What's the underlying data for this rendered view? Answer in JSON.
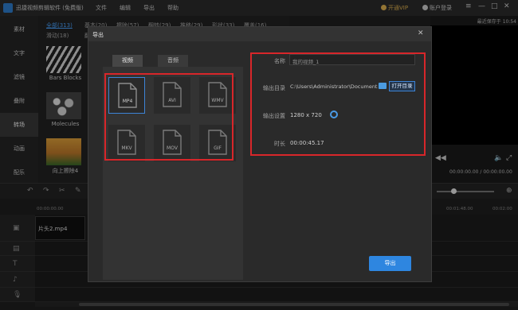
{
  "app": {
    "title": "迅捷视频剪辑软件 (免费版)",
    "menu": [
      "文件",
      "编辑",
      "导出",
      "帮助"
    ],
    "vip_label": "开通VIP",
    "login_label": "账户登录",
    "window_controls": [
      "≡",
      "—",
      "□",
      "✕"
    ]
  },
  "sidebar": {
    "items": [
      {
        "label": "素材",
        "active": false
      },
      {
        "label": "文字",
        "active": false
      },
      {
        "label": "滤镜",
        "active": false
      },
      {
        "label": "叠附",
        "active": false
      },
      {
        "label": "转场",
        "active": true
      },
      {
        "label": "动画",
        "active": false
      },
      {
        "label": "配乐",
        "active": false
      }
    ]
  },
  "resources": {
    "tabs_row1": [
      "全部(313)",
      "基本(20)",
      "擦除(57)",
      "翻转(29)",
      "推移(29)",
      "形状(33)",
      "覆盖(16)"
    ],
    "tabs_row2": [
      "滑动(18)",
      "翻"
    ],
    "thumbnails": [
      {
        "label": "Bars Blocks"
      },
      {
        "label": "Molecules"
      },
      {
        "label": "向上擦除4"
      }
    ]
  },
  "preview": {
    "recent_time": "最近保存于 10:54",
    "timecode": "00:00:00.00 / 00:00:00.00",
    "prev_icon": "◀◀",
    "play_icon": "▶",
    "volume_icon": "volume-icon",
    "fullscreen_icon": "fullscreen-icon"
  },
  "timeline": {
    "ruler_ticks": [
      "00:00:00.00",
      "00:01:48.00",
      "00:02:00"
    ],
    "clip_label": "片头2.mp4",
    "toolbar_icons": [
      "↶",
      "↷",
      "✂",
      "✎",
      "⬚"
    ]
  },
  "export_dialog": {
    "title": "导出",
    "close": "✕",
    "tabs": [
      {
        "label": "视频",
        "active": true
      },
      {
        "label": "音频",
        "active": false
      }
    ],
    "formats": [
      {
        "label": "MP4",
        "selected": true
      },
      {
        "label": "AVI",
        "selected": false
      },
      {
        "label": "WMV",
        "selected": false
      },
      {
        "label": "MKV",
        "selected": false
      },
      {
        "label": "MOV",
        "selected": false
      },
      {
        "label": "GIF",
        "selected": false
      }
    ],
    "fields": {
      "name_label": "名称",
      "name_value": "我的视频_1",
      "dir_label": "输出目录",
      "dir_value": "C:\\Users\\Administrator\\Documents",
      "open_dir_button": "打开目录",
      "settings_label": "输出设置",
      "settings_value": "1280 x 720",
      "duration_label": "时长",
      "duration_value": "00:00:45.17"
    },
    "export_button": "导出",
    "highlight_color": "#d8262a",
    "accent_color": "#2e86e0"
  }
}
